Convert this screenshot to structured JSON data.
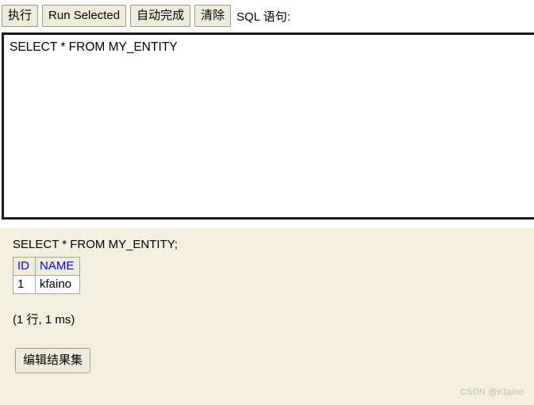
{
  "toolbar": {
    "buttons": [
      {
        "name": "execute",
        "label": "执行"
      },
      {
        "name": "run-selected",
        "label": "Run Selected"
      },
      {
        "name": "auto-complete",
        "label": "自动完成"
      },
      {
        "name": "clear",
        "label": "清除"
      }
    ],
    "sql_label": "SQL 语句:"
  },
  "editor": {
    "value": "SELECT * FROM MY_ENTITY",
    "placeholder": ""
  },
  "result": {
    "query": "SELECT * FROM MY_ENTITY;",
    "columns": [
      "ID",
      "NAME"
    ],
    "rows": [
      [
        "1",
        "kfaino"
      ]
    ],
    "status": "(1 行, 1 ms)",
    "edit_button_label": "编辑结果集",
    "watermark": "CSDN @Kfaino"
  },
  "colors": {
    "panel_background": "#f2efdf",
    "button_background": "#efecdc",
    "button_border": "#9a9a8c",
    "header_text": "#0000ff",
    "editor_border": "#1a1a1a",
    "watermark_text": "#bdbcae"
  }
}
